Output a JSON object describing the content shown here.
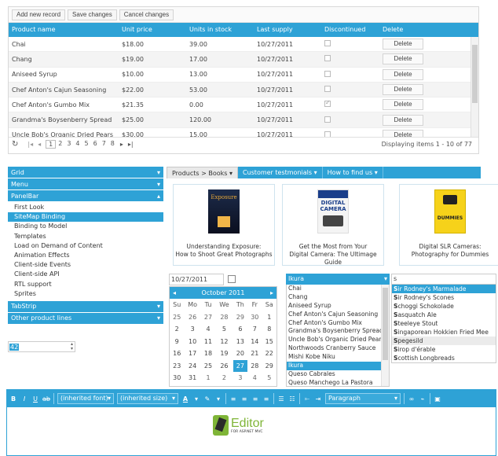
{
  "grid": {
    "toolbar": {
      "add": "Add new record",
      "save": "Save changes",
      "cancel": "Cancel changes"
    },
    "columns": [
      "Product name",
      "Unit price",
      "Units in stock",
      "Last supply",
      "Discontinued",
      "Delete"
    ],
    "rows": [
      {
        "name": "Chai",
        "price": "$18.00",
        "stock": "39.00",
        "supply": "10/27/2011",
        "disc": false
      },
      {
        "name": "Chang",
        "price": "$19.00",
        "stock": "17.00",
        "supply": "10/27/2011",
        "disc": false
      },
      {
        "name": "Aniseed Syrup",
        "price": "$10.00",
        "stock": "13.00",
        "supply": "10/27/2011",
        "disc": false
      },
      {
        "name": "Chef Anton's Cajun Seasoning",
        "price": "$22.00",
        "stock": "53.00",
        "supply": "10/27/2011",
        "disc": false
      },
      {
        "name": "Chef Anton's Gumbo Mix",
        "price": "$21.35",
        "stock": "0.00",
        "supply": "10/27/2011",
        "disc": true
      },
      {
        "name": "Grandma's Boysenberry Spread",
        "price": "$25.00",
        "stock": "120.00",
        "supply": "10/27/2011",
        "disc": false
      },
      {
        "name": "Uncle Bob's Organic Dried Pears",
        "price": "$30.00",
        "stock": "15.00",
        "supply": "10/27/2011",
        "disc": false
      }
    ],
    "delete_label": "Delete",
    "pager": {
      "pages": [
        "1",
        "2",
        "3",
        "4",
        "5",
        "6",
        "7",
        "8"
      ],
      "info": "Displaying items 1 - 10 of 77"
    }
  },
  "panelbar": {
    "grid": "Grid",
    "menu": "Menu",
    "panelbar": "PanelBar",
    "items": [
      "First Look",
      "SiteMap Binding",
      "Binding to Model",
      "Templates",
      "Load on Demand of Content",
      "Animation Effects",
      "Client-side Events",
      "Client-side API",
      "RTL support",
      "Sprites"
    ],
    "tabstrip": "TabStrip",
    "other": "Other product lines"
  },
  "numeric": {
    "value": "42"
  },
  "tabs": {
    "items": [
      "Products > Books",
      "Customer testmonials",
      "How to find us"
    ],
    "books": [
      {
        "line1": "Understanding Exposure:",
        "line2": "How to Shoot Great Photographs",
        "cover": "Exposure"
      },
      {
        "line1": "Get the Most from Your",
        "line2": "Digital Camera: The Ultimage Guide",
        "cover": "DIGITAL CAMERA"
      },
      {
        "line1": "Digital SLR Cameras:",
        "line2": "Photography for Dummies",
        "cover": "DUMMIES"
      }
    ]
  },
  "datepicker": {
    "value": "10/27/2011"
  },
  "calendar": {
    "title": "October 2011",
    "weekdays": [
      "Su",
      "Mo",
      "Tu",
      "We",
      "Th",
      "Fr",
      "Sa"
    ],
    "weeks": [
      [
        "25",
        "26",
        "27",
        "28",
        "29",
        "30",
        "1"
      ],
      [
        "2",
        "3",
        "4",
        "5",
        "6",
        "7",
        "8"
      ],
      [
        "9",
        "10",
        "11",
        "12",
        "13",
        "14",
        "15"
      ],
      [
        "16",
        "17",
        "18",
        "19",
        "20",
        "21",
        "22"
      ],
      [
        "23",
        "24",
        "25",
        "26",
        "27",
        "28",
        "29"
      ],
      [
        "30",
        "31",
        "1",
        "2",
        "3",
        "4",
        "5"
      ]
    ],
    "selected": "27"
  },
  "combo": {
    "value": "Ikura",
    "items": [
      "Ikura",
      "Chai",
      "Chang",
      "Aniseed Syrup",
      "Chef Anton's Cajun Seasoning",
      "Chef Anton's Gumbo Mix",
      "Grandma's Boysenberry Spread",
      "Uncle Bob's Organic Dried Pears",
      "Northwoods Cranberry Sauce",
      "Mishi Kobe Niku",
      "Ikura",
      "Queso Cabrales",
      "Queso Manchego La Pastora"
    ]
  },
  "autocomplete": {
    "value": "s",
    "items": [
      {
        "first": "S",
        "rest": "ir Rodney's Marmalade"
      },
      {
        "first": "S",
        "rest": "ir Rodney's Scones"
      },
      {
        "first": "S",
        "rest": "choggi Schokolade"
      },
      {
        "first": "S",
        "rest": "asquatch Ale"
      },
      {
        "first": "S",
        "rest": "teeleye Stout"
      },
      {
        "first": "S",
        "rest": "ingaporean Hokkien Fried Mee"
      },
      {
        "first": "S",
        "rest": "pegesild"
      },
      {
        "first": "S",
        "rest": "irop d'érable"
      },
      {
        "first": "S",
        "rest": "cottish Longbreads"
      }
    ]
  },
  "editor": {
    "font": "(inherited font)",
    "size": "(inherited size)",
    "format": "Paragraph",
    "logo_title": "Editor",
    "logo_sub": "FOR ASP.NET MVC"
  },
  "colors": {
    "accent": "#2ea2d6"
  }
}
